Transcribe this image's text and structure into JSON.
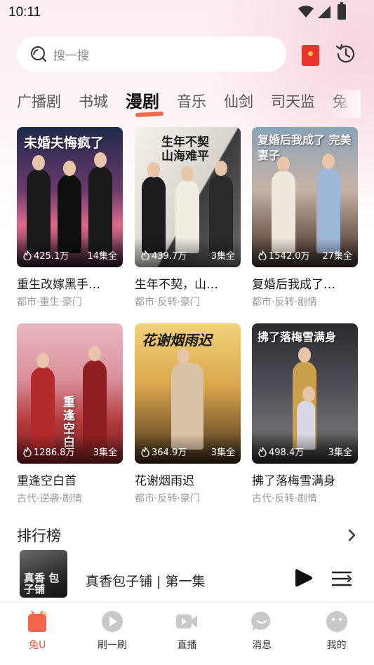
{
  "status_bar": {
    "time": "10:11"
  },
  "search": {
    "placeholder": "搜一搜"
  },
  "tabs": [
    {
      "label": "广播剧",
      "active": false
    },
    {
      "label": "书城",
      "active": false
    },
    {
      "label": "漫剧",
      "active": true
    },
    {
      "label": "音乐",
      "active": false
    },
    {
      "label": "仙剑",
      "active": false
    },
    {
      "label": "司天监",
      "active": false
    },
    {
      "label": "兔",
      "active": false
    }
  ],
  "dramas": [
    {
      "poster_title": "未婚夫悔疯了",
      "views": "425.1万",
      "episodes": "14集全",
      "title": "重生改嫁黑手…",
      "tags": "都市·重生·豪门"
    },
    {
      "poster_title": "生年不契 山海难平",
      "views": "439.7万",
      "episodes": "3集全",
      "title": "生年不契，山…",
      "tags": "都市·反转·豪门"
    },
    {
      "poster_title": "复婚后我成了 完美妻子",
      "views": "1542.0万",
      "episodes": "27集全",
      "title": "复婚后我成了…",
      "tags": "都市·反转·剧情"
    },
    {
      "poster_title": "重逢空白",
      "views": "1286.8万",
      "episodes": "3集全",
      "title": "重逢空白首",
      "tags": "古代·逆袭·剧情"
    },
    {
      "poster_title": "花谢烟雨迟",
      "views": "364.9万",
      "episodes": "3集全",
      "title": "花谢烟雨迟",
      "tags": "都市·反转·豪门"
    },
    {
      "poster_title": "拂了落梅雪满身",
      "views": "498.4万",
      "episodes": "3集全",
      "title": "拂了落梅雪满身",
      "tags": "古代·反转·剧情"
    }
  ],
  "ranking": {
    "title": "排行榜"
  },
  "player": {
    "cover_text": "真香 包子铺",
    "title": "真香包子铺 | 第一集"
  },
  "nav": [
    {
      "label": "兔U",
      "icon": "rabbit-home-icon",
      "active": true
    },
    {
      "label": "刷一刷",
      "icon": "play-circle-icon",
      "active": false
    },
    {
      "label": "直播",
      "icon": "live-video-icon",
      "active": false
    },
    {
      "label": "消息",
      "icon": "message-bubble-icon",
      "active": false
    },
    {
      "label": "我的",
      "icon": "profile-face-icon",
      "active": false
    }
  ],
  "colors": {
    "accent": "#ee4b3b",
    "tab_underline": "#ee6a4d",
    "background_tint": "#fbeff2"
  }
}
